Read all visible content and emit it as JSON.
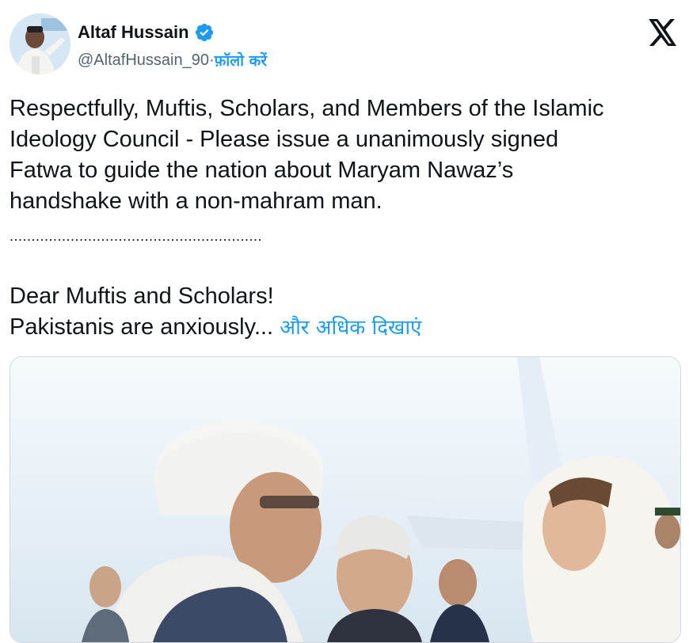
{
  "tweet": {
    "author": {
      "name": "Altaf Hussain",
      "handle": "@AltafHussain_90",
      "separator": " · ",
      "follow_label": "फ़ॉलो करें"
    },
    "text_lines": [
      "Respectfully, Muftis, Scholars, and Members of the Islamic",
      "Ideology Council - Please issue a unanimously signed",
      "Fatwa to guide the nation about Maryam Nawaz’s",
      "handshake with a non-mahram man."
    ],
    "divider": "..........................................................",
    "text2_line1": "Dear Muftis and Scholars!",
    "text2_line2": "Pakistanis are anxiously...",
    "show_more_label": "और अधिक दिखाएं"
  },
  "icons": {
    "verified": "verified-badge-icon",
    "x_logo": "x-logo-icon"
  },
  "colors": {
    "link": "#1d9bf0",
    "text": "#0f1419",
    "secondary": "#536471"
  }
}
